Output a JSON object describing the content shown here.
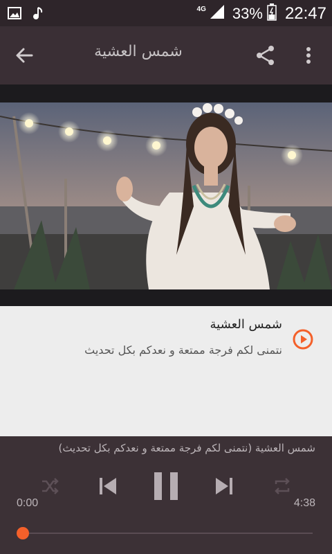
{
  "status_bar": {
    "network": "4G",
    "battery_pct": "33%",
    "time": "22:47",
    "icons": [
      "image-icon",
      "music-note-icon",
      "signal-icon",
      "battery-icon"
    ]
  },
  "app_bar": {
    "title": "شمس العشية",
    "icons": [
      "back-arrow-icon",
      "share-icon",
      "more-vert-icon"
    ]
  },
  "track": {
    "title": "شمس العشية",
    "subtitle": "نتمنى لكم فرجة ممتعة و نعدكم بكل تحديث",
    "icon": "play-circle-icon"
  },
  "player": {
    "now_playing": "شمس العشية (نتمنى لكم فرجة ممتعة و نعدكم بكل تحديث)",
    "current_time": "0:00",
    "total_time": "4:38",
    "progress": 0,
    "icons": [
      "shuffle-icon",
      "skip-previous-icon",
      "pause-icon",
      "skip-next-icon",
      "repeat-icon"
    ]
  },
  "colors": {
    "accent": "#f4602a",
    "app_bar": "#3a2f35",
    "player": "#3c3136"
  }
}
